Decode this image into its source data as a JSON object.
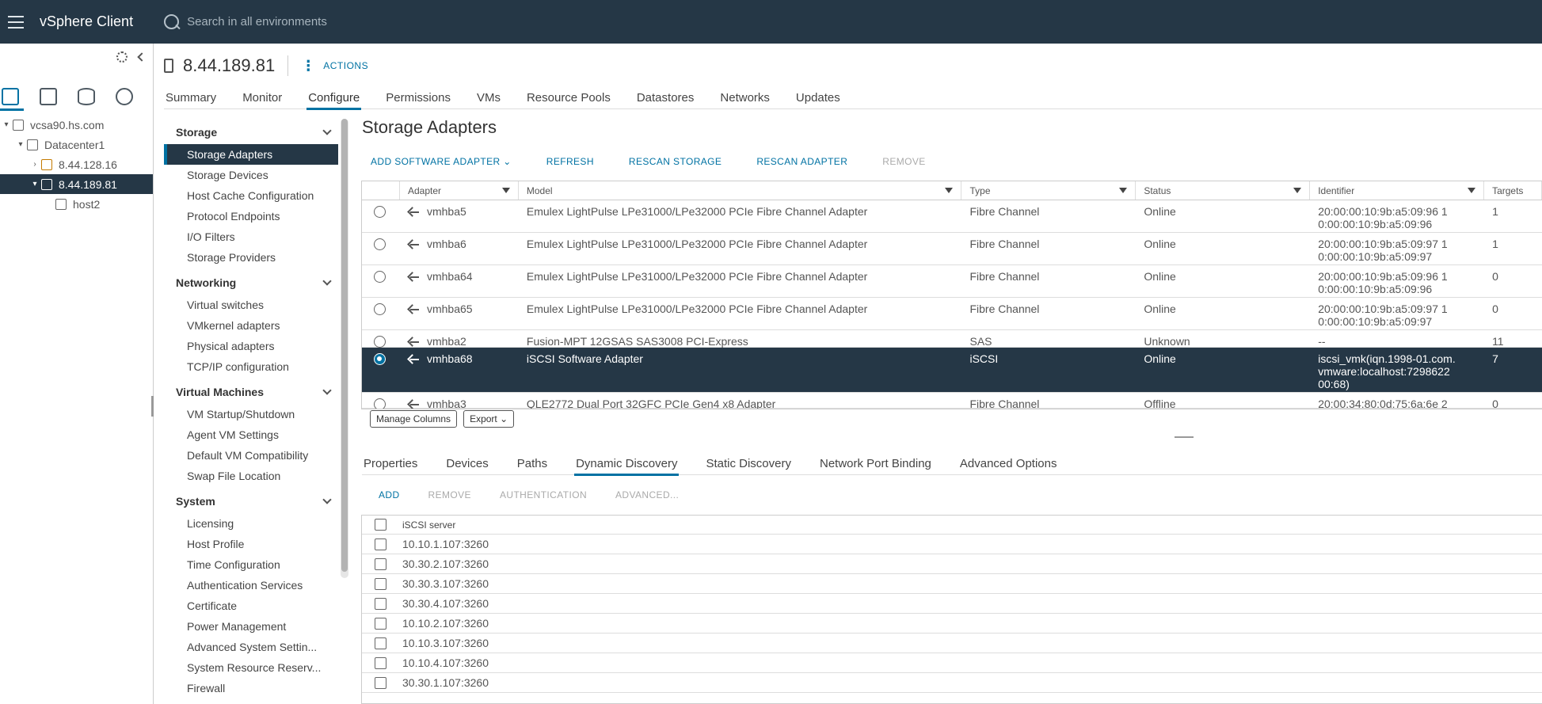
{
  "app": {
    "title": "vSphere Client",
    "search_placeholder": "Search in all environments"
  },
  "tree": [
    {
      "label": "vcsa90.hs.com",
      "level": 0,
      "caret": "▾",
      "icon": "vcenter-icon",
      "selected": false
    },
    {
      "label": "Datacenter1",
      "level": 1,
      "caret": "▾",
      "icon": "datacenter-icon",
      "selected": false
    },
    {
      "label": "8.44.128.16",
      "level": 2,
      "caret": "›",
      "icon": "host-warning-icon",
      "selected": false
    },
    {
      "label": "8.44.189.81",
      "level": 2,
      "caret": "▾",
      "icon": "host-icon",
      "selected": true
    },
    {
      "label": "host2",
      "level": 3,
      "caret": "",
      "icon": "vm-icon",
      "selected": false
    }
  ],
  "object": {
    "title": "8.44.189.81",
    "actions_label": "ACTIONS",
    "tabs": [
      "Summary",
      "Monitor",
      "Configure",
      "Permissions",
      "VMs",
      "Resource Pools",
      "Datastores",
      "Networks",
      "Updates"
    ],
    "active_tab": "Configure"
  },
  "config_nav": [
    {
      "section": "Storage",
      "items": [
        "Storage Adapters",
        "Storage Devices",
        "Host Cache Configuration",
        "Protocol Endpoints",
        "I/O Filters",
        "Storage Providers"
      ]
    },
    {
      "section": "Networking",
      "items": [
        "Virtual switches",
        "VMkernel adapters",
        "Physical adapters",
        "TCP/IP configuration"
      ]
    },
    {
      "section": "Virtual Machines",
      "items": [
        "VM Startup/Shutdown",
        "Agent VM Settings",
        "Default VM Compatibility",
        "Swap File Location"
      ]
    },
    {
      "section": "System",
      "items": [
        "Licensing",
        "Host Profile",
        "Time Configuration",
        "Authentication Services",
        "Certificate",
        "Power Management",
        "Advanced System Settin...",
        "System Resource Reserv...",
        "Firewall"
      ]
    }
  ],
  "config_selected": "Storage Adapters",
  "main": {
    "title": "Storage Adapters",
    "toolbar": [
      {
        "label": "ADD SOFTWARE ADAPTER ⌄",
        "disabled": false
      },
      {
        "label": "REFRESH",
        "disabled": false
      },
      {
        "label": "RESCAN STORAGE",
        "disabled": false
      },
      {
        "label": "RESCAN ADAPTER",
        "disabled": false
      },
      {
        "label": "REMOVE",
        "disabled": true
      }
    ],
    "columns": [
      "Adapter",
      "Model",
      "Type",
      "Status",
      "Identifier",
      "Targets"
    ],
    "rows": [
      {
        "adapter": "vmhba5",
        "model": "Emulex LightPulse LPe31000/LPe32000 PCIe Fibre Channel Adapter",
        "type": "Fibre Channel",
        "status": "Online",
        "identifier": "20:00:00:10:9b:a5:09:96 1\n0:00:00:10:9b:a5:09:96",
        "targets": "1",
        "selected": false
      },
      {
        "adapter": "vmhba6",
        "model": "Emulex LightPulse LPe31000/LPe32000 PCIe Fibre Channel Adapter",
        "type": "Fibre Channel",
        "status": "Online",
        "identifier": "20:00:00:10:9b:a5:09:97 1\n0:00:00:10:9b:a5:09:97",
        "targets": "1",
        "selected": false
      },
      {
        "adapter": "vmhba64",
        "model": "Emulex LightPulse LPe31000/LPe32000 PCIe Fibre Channel Adapter",
        "type": "Fibre Channel",
        "status": "Online",
        "identifier": "20:00:00:10:9b:a5:09:96 1\n0:00:00:10:9b:a5:09:96",
        "targets": "0",
        "selected": false
      },
      {
        "adapter": "vmhba65",
        "model": "Emulex LightPulse LPe31000/LPe32000 PCIe Fibre Channel Adapter",
        "type": "Fibre Channel",
        "status": "Online",
        "identifier": "20:00:00:10:9b:a5:09:97 1\n0:00:00:10:9b:a5:09:97",
        "targets": "0",
        "selected": false
      },
      {
        "adapter": "vmhba2",
        "model": "Fusion-MPT 12GSAS SAS3008 PCI-Express",
        "type": "SAS",
        "status": "Unknown",
        "identifier": "--",
        "targets": "11",
        "selected": false
      },
      {
        "adapter": "vmhba68",
        "model": "iSCSI Software Adapter",
        "type": "iSCSI",
        "status": "Online",
        "identifier": "iscsi_vmk(iqn.1998-01.com.\nvmware:localhost:7298622\n00:68)",
        "targets": "7",
        "selected": true
      },
      {
        "adapter": "vmhba3",
        "model": "QLE2772 Dual Port 32GFC PCIe Gen4 x8 Adapter",
        "type": "Fibre Channel",
        "status": "Offline",
        "identifier": "20:00:34:80:0d:75:6a:6e 2",
        "targets": "0",
        "selected": false
      }
    ],
    "manage_columns": "Manage Columns",
    "export": "Export ⌄"
  },
  "detail": {
    "tabs": [
      "Properties",
      "Devices",
      "Paths",
      "Dynamic Discovery",
      "Static Discovery",
      "Network Port Binding",
      "Advanced Options"
    ],
    "active_tab": "Dynamic Discovery",
    "toolbar": [
      {
        "label": "ADD",
        "disabled": false
      },
      {
        "label": "REMOVE",
        "disabled": true
      },
      {
        "label": "AUTHENTICATION",
        "disabled": true
      },
      {
        "label": "ADVANCED...",
        "disabled": true
      }
    ],
    "column": "iSCSI server",
    "servers": [
      "10.10.1.107:3260",
      "30.30.2.107:3260",
      "30.30.3.107:3260",
      "30.30.4.107:3260",
      "10.10.2.107:3260",
      "10.10.3.107:3260",
      "10.10.4.107:3260",
      "30.30.1.107:3260"
    ]
  },
  "colors": {
    "header": "#253746",
    "accent": "#0072a3",
    "selected_row": "#253746"
  }
}
